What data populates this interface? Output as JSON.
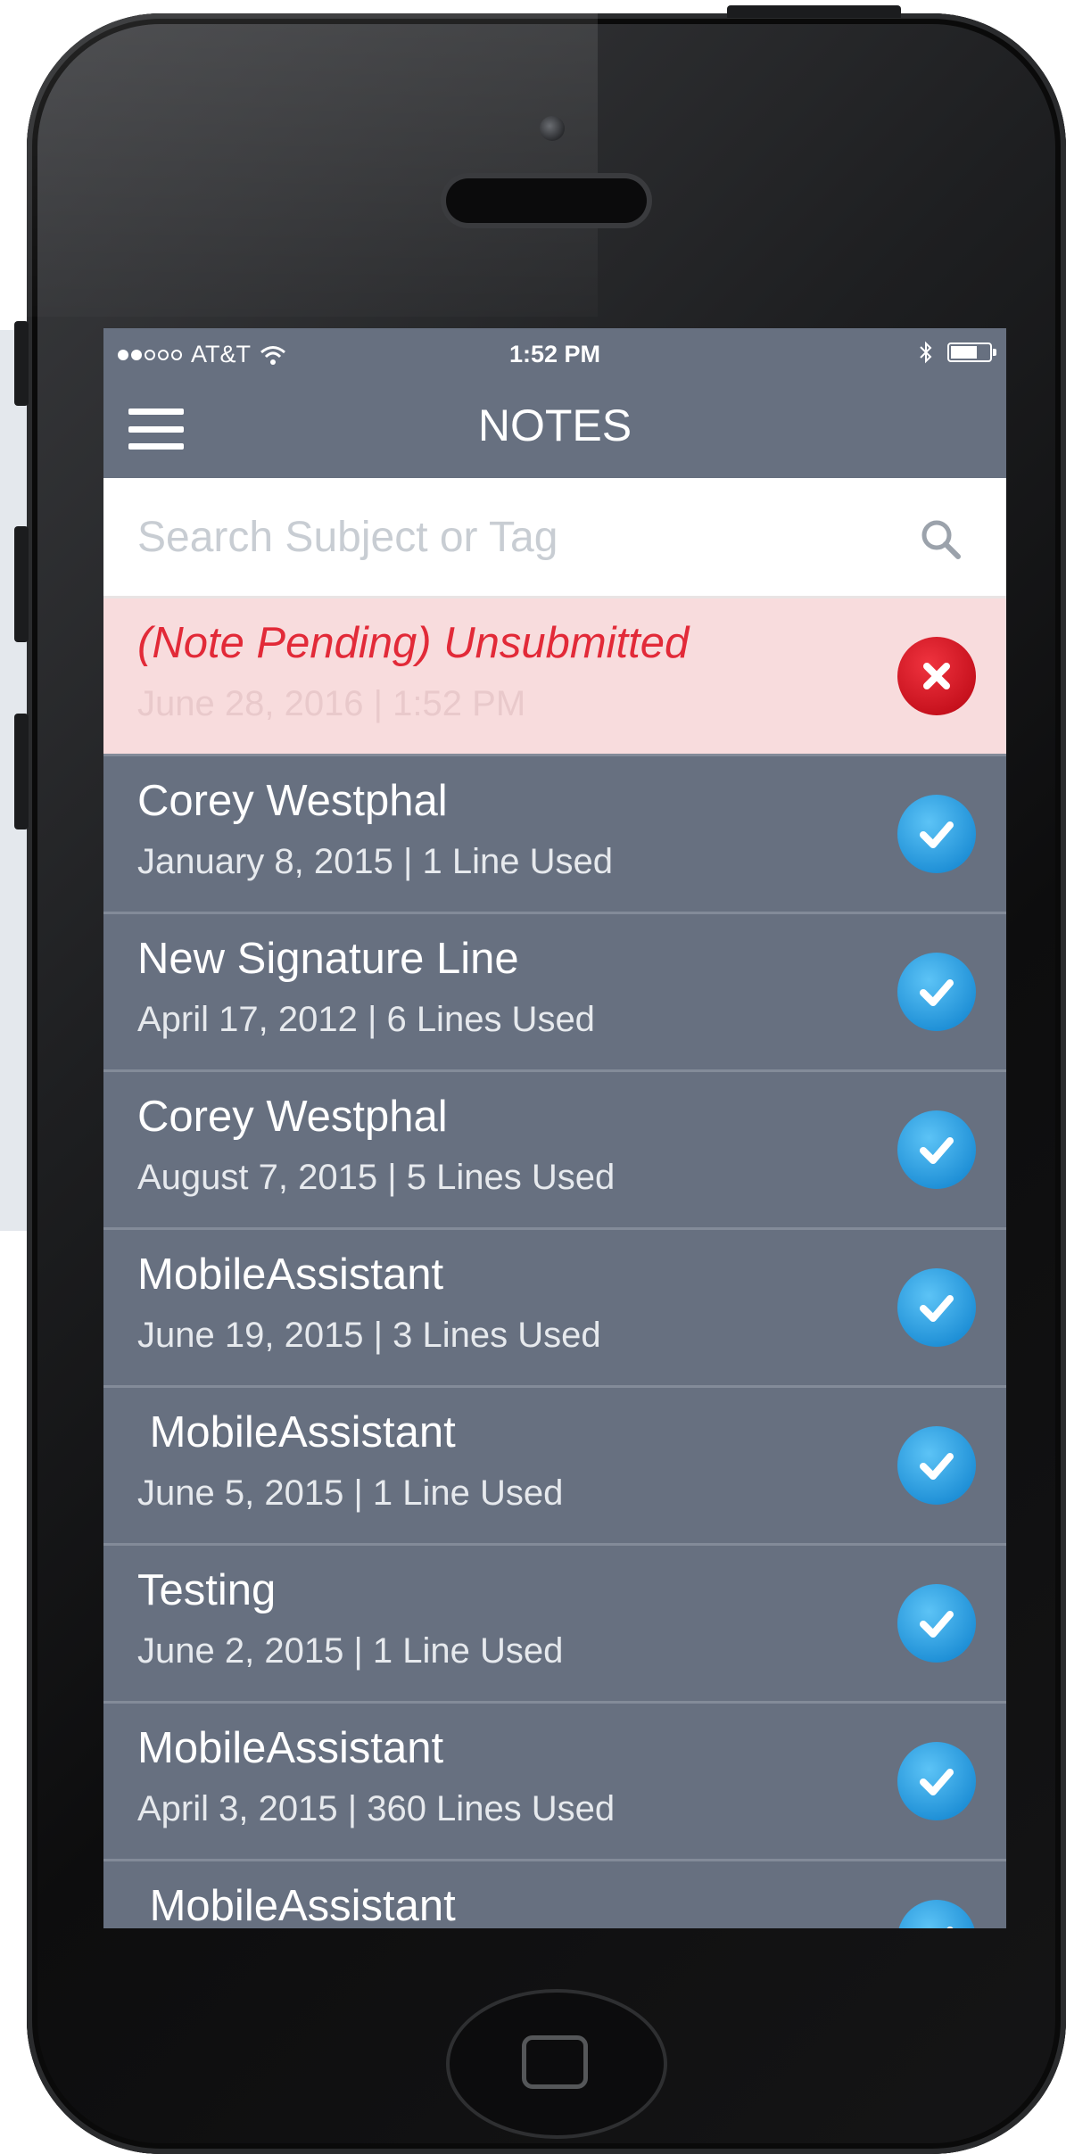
{
  "status_bar": {
    "carrier": "AT&T",
    "time": "1:52 PM"
  },
  "nav": {
    "title": "NOTES"
  },
  "search": {
    "placeholder": "Search Subject or Tag",
    "value": ""
  },
  "notes": [
    {
      "title": "(Note Pending) Unsubmitted",
      "subtitle": "June 28, 2016 | 1:52 PM",
      "status": "error"
    },
    {
      "title": "Corey Westphal",
      "subtitle": "January 8, 2015 | 1 Line Used",
      "status": "submitted"
    },
    {
      "title": "New Signature Line",
      "subtitle": "April 17, 2012 | 6 Lines Used",
      "status": "submitted"
    },
    {
      "title": "Corey Westphal",
      "subtitle": "August 7, 2015 | 5 Lines Used",
      "status": "submitted"
    },
    {
      "title": "MobileAssistant",
      "subtitle": "June 19, 2015 | 3 Lines Used",
      "status": "submitted"
    },
    {
      "title": " MobileAssistant",
      "subtitle": "June 5, 2015 | 1 Line Used",
      "status": "submitted"
    },
    {
      "title": "Testing",
      "subtitle": "June 2, 2015 | 1 Line Used",
      "status": "submitted"
    },
    {
      "title": "MobileAssistant",
      "subtitle": "April 3, 2015 | 360 Lines Used",
      "status": "submitted"
    },
    {
      "title": " MobileAssistant",
      "subtitle": "",
      "status": "submitted"
    }
  ],
  "icons": {
    "menu": "hamburger-menu-icon",
    "search": "search-icon",
    "submitted": "checkmark-circle-icon",
    "error": "x-circle-icon",
    "wifi": "wifi-icon",
    "bluetooth": "bluetooth-icon",
    "battery": "battery-icon"
  },
  "colors": {
    "screen_bg": "#677080",
    "pending_bg": "#f8dcdd",
    "pending_text": "#e22a38",
    "check_blue": "#1e8fd6",
    "error_red": "#c5101c"
  },
  "battery_level": 0.7
}
